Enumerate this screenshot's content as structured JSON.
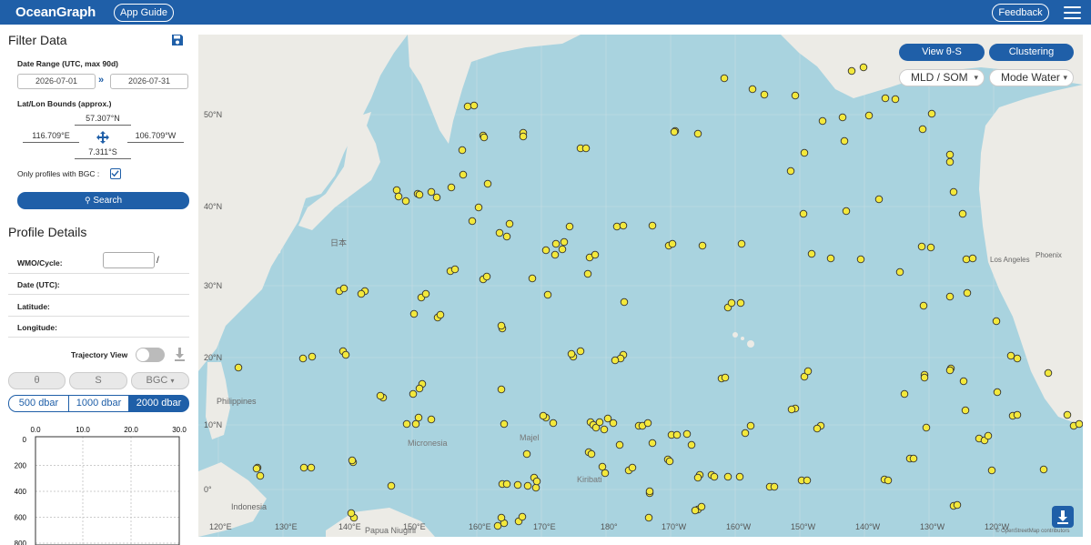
{
  "header": {
    "logo": "OceanGraph",
    "app_guide": "App Guide",
    "feedback": "Feedback"
  },
  "filter": {
    "title": "Filter Data",
    "date_range_label": "Date Range (UTC, max 90d)",
    "date_start": "2026-07-01",
    "date_end": "2026-07-31",
    "bounds_label": "Lat/Lon Bounds (approx.)",
    "north": "57.307°N",
    "west": "116.709°E",
    "east": "106.709°W",
    "south": "7.311°S",
    "bgc_label": "Only profiles with BGC :",
    "bgc_checked": true,
    "search_label": "Search"
  },
  "profile": {
    "title": "Profile Details",
    "wmo_label": "WMO/Cycle:",
    "wmo_sep": "/",
    "date_label": "Date (UTC):",
    "lat_label": "Latitude:",
    "lon_label": "Longitude:",
    "trajectory_label": "Trajectory View",
    "vars": [
      "θ",
      "S",
      "BGC"
    ],
    "depths": [
      "500 dbar",
      "1000 dbar",
      "2000 dbar"
    ],
    "active_depth": "2000 dbar"
  },
  "plot": {
    "x_ticks": [
      "0.0",
      "10.0",
      "20.0",
      "30.0"
    ],
    "y_ticks": [
      "0",
      "200",
      "400",
      "600",
      "800"
    ]
  },
  "map": {
    "view_ts": "View θ-S",
    "clustering": "Clustering",
    "layer_select": "MLD / SOM",
    "mode_select": "Mode Water",
    "attribution": "© OpenStreetMap contributors",
    "lon_labels": [
      "120°E",
      "130°E",
      "140°E",
      "150°E",
      "160°E",
      "170°E",
      "180°",
      "170°W",
      "160°W",
      "150°W",
      "140°W",
      "130°W",
      "120°W"
    ],
    "lat_labels": [
      "50°N",
      "40°N",
      "30°N",
      "20°N",
      "10°N",
      "0°"
    ],
    "place_labels": [
      "Micronesia",
      "Kiribati",
      "Papua Niugini",
      "Indonesia",
      "Philippines",
      "Majel",
      "Los Angeles",
      "Phoenix",
      "日本"
    ],
    "colors": {
      "ocean": "#a9d3df",
      "land": "#ecebe6",
      "float": "#f3e83c"
    }
  }
}
